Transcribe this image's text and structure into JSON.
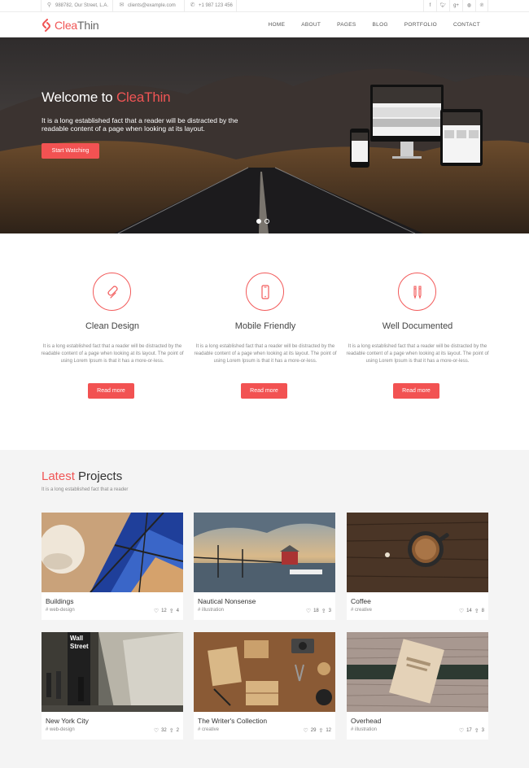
{
  "topbar": {
    "address": "988782, Our Street, L.A.",
    "email": "clients@example.com",
    "phone": "+1 987 123 456",
    "social": [
      "f",
      "t",
      "g+",
      "dribbble-icon",
      "pinterest-icon"
    ]
  },
  "brand": {
    "name_a": "Clea",
    "name_b": "Thin"
  },
  "nav": [
    "HOME",
    "ABOUT",
    "PAGES",
    "BLOG",
    "PORTFOLIO",
    "CONTACT"
  ],
  "hero": {
    "title_prefix": "Welcome to ",
    "title_accent": "CleaThin",
    "text": "It is a long established fact that a reader will be distracted by the readable content of a page when looking at its layout.",
    "cta": "Start Watching",
    "slides": 2,
    "active_slide": 1
  },
  "features": [
    {
      "title": "Clean Design",
      "icon": "paperclip-icon",
      "text": "It is a long established fact that a reader will be distracted by the readable content of a page when looking at its layout. The point of using Lorem Ipsum is that it has a more-or-less.",
      "button": "Read more"
    },
    {
      "title": "Mobile Friendly",
      "icon": "mobile-icon",
      "text": "It is a long established fact that a reader will be distracted by the readable content of a page when looking at its layout. The point of using Lorem Ipsum is that it has a more-or-less.",
      "button": "Read more"
    },
    {
      "title": "Well Documented",
      "icon": "pencils-icon",
      "text": "It is a long established fact that a reader will be distracted by the readable content of a page when looking at its layout. The point of using Lorem Ipsum is that it has a more-or-less.",
      "button": "Read more"
    }
  ],
  "projects": {
    "title_accent": "Latest",
    "title_rest": " Projects",
    "subtitle": "It is a long established fact that a reader",
    "items": [
      {
        "title": "Buildings",
        "tag": "# web-design",
        "likes": "12",
        "shares": "4"
      },
      {
        "title": "Nautical Nonsense",
        "tag": "# illustration",
        "likes": "18",
        "shares": "3"
      },
      {
        "title": "Coffee",
        "tag": "# creative",
        "likes": "14",
        "shares": "8"
      },
      {
        "title": "New York City",
        "tag": "# web-design",
        "likes": "32",
        "shares": "2",
        "sign_1": "Wall",
        "sign_2": "Street"
      },
      {
        "title": "The Writer's Collection",
        "tag": "# creative",
        "likes": "29",
        "shares": "12"
      },
      {
        "title": "Overhead",
        "tag": "# illustration",
        "likes": "17",
        "shares": "3"
      }
    ]
  },
  "colors": {
    "accent": "#f25252",
    "dark_text": "#333333",
    "muted": "#888888",
    "section_bg": "#f4f4f4"
  }
}
